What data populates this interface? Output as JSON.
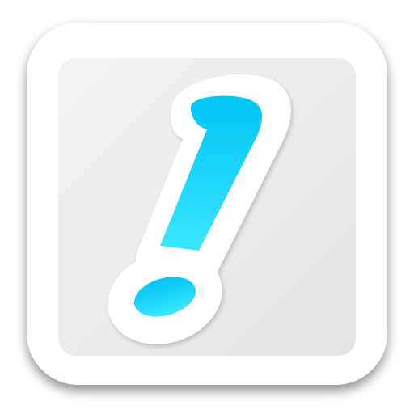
{
  "icon": {
    "name": "exclamation-mark-icon",
    "colors": {
      "background": "#ffffff",
      "tile_outer": "#ffffff",
      "tile_inner_light": "#f3f3f3",
      "tile_inner_dark": "#e3e3e3",
      "glyph_outline": "#ffffff",
      "glyph_top": "#00c4f5",
      "glyph_bottom": "#3ae6ff",
      "shadow": "#000000"
    }
  }
}
